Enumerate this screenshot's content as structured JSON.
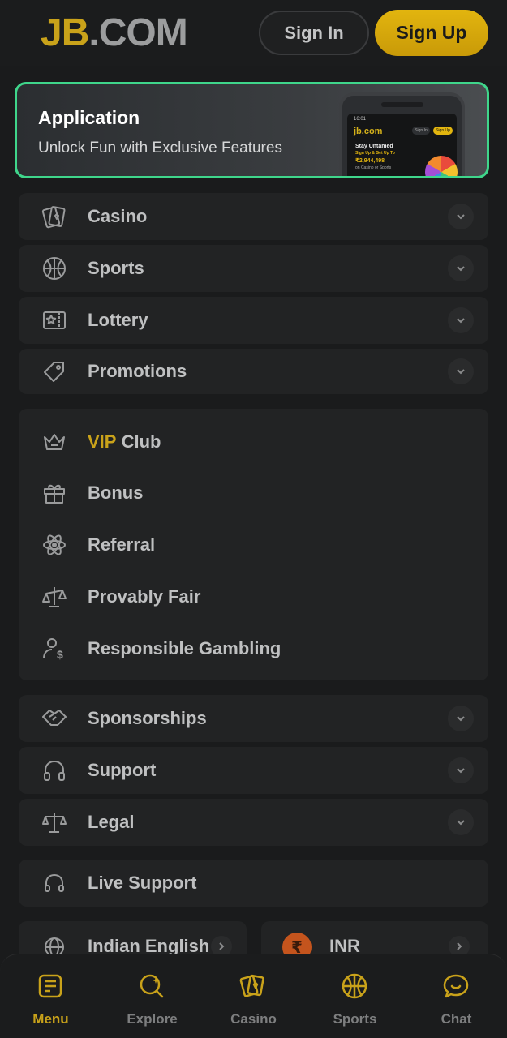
{
  "header": {
    "logo_jb": "JB",
    "logo_com": ".COM",
    "signin_label": "Sign In",
    "signup_label": "Sign Up"
  },
  "app_banner": {
    "title": "Application",
    "subtitle": "Unlock Fun with Exclusive Features",
    "phone": {
      "time": "16:01",
      "logo": "jb.com",
      "signin": "Sign In",
      "signup": "Sign Up",
      "headline": "Stay Untamed",
      "line2": "Sign Up & Get Up To",
      "amount": "₹2,944,498",
      "line4": "on Casino or Sports"
    }
  },
  "menu": {
    "expandable": [
      {
        "label": "Casino",
        "icon": "cards-icon"
      },
      {
        "label": "Sports",
        "icon": "basketball-icon"
      },
      {
        "label": "Lottery",
        "icon": "lottery-ticket-icon"
      },
      {
        "label": "Promotions",
        "icon": "tag-icon"
      }
    ],
    "links": [
      {
        "label_highlight": "VIP",
        "label": "Club",
        "icon": "crown-icon"
      },
      {
        "label": "Bonus",
        "icon": "gift-icon"
      },
      {
        "label": "Referral",
        "icon": "atom-icon"
      },
      {
        "label": "Provably Fair",
        "icon": "balance-scale-icon"
      },
      {
        "label": "Responsible Gambling",
        "icon": "user-dollar-icon"
      }
    ],
    "expandable2": [
      {
        "label": "Sponsorships",
        "icon": "handshake-icon"
      },
      {
        "label": "Support",
        "icon": "headphones-icon"
      },
      {
        "label": "Legal",
        "icon": "legal-scale-icon"
      }
    ],
    "live_support": {
      "label": "Live Support",
      "icon": "headset-icon"
    },
    "language": {
      "label": "Indian English",
      "icon": "globe-icon"
    },
    "currency": {
      "label": "INR",
      "symbol": "₹"
    }
  },
  "bottom_nav": [
    {
      "label": "Menu",
      "icon": "menu-list-icon",
      "active": true
    },
    {
      "label": "Explore",
      "icon": "explore-search-icon",
      "active": false
    },
    {
      "label": "Casino",
      "icon": "cards-icon",
      "active": false
    },
    {
      "label": "Sports",
      "icon": "basketball-icon",
      "active": false
    },
    {
      "label": "Chat",
      "icon": "chat-bubble-icon",
      "active": false
    }
  ],
  "colors": {
    "accent": "#c9a21a",
    "banner_border": "#3fd68b",
    "background": "#1a1b1c",
    "card": "#222324"
  }
}
